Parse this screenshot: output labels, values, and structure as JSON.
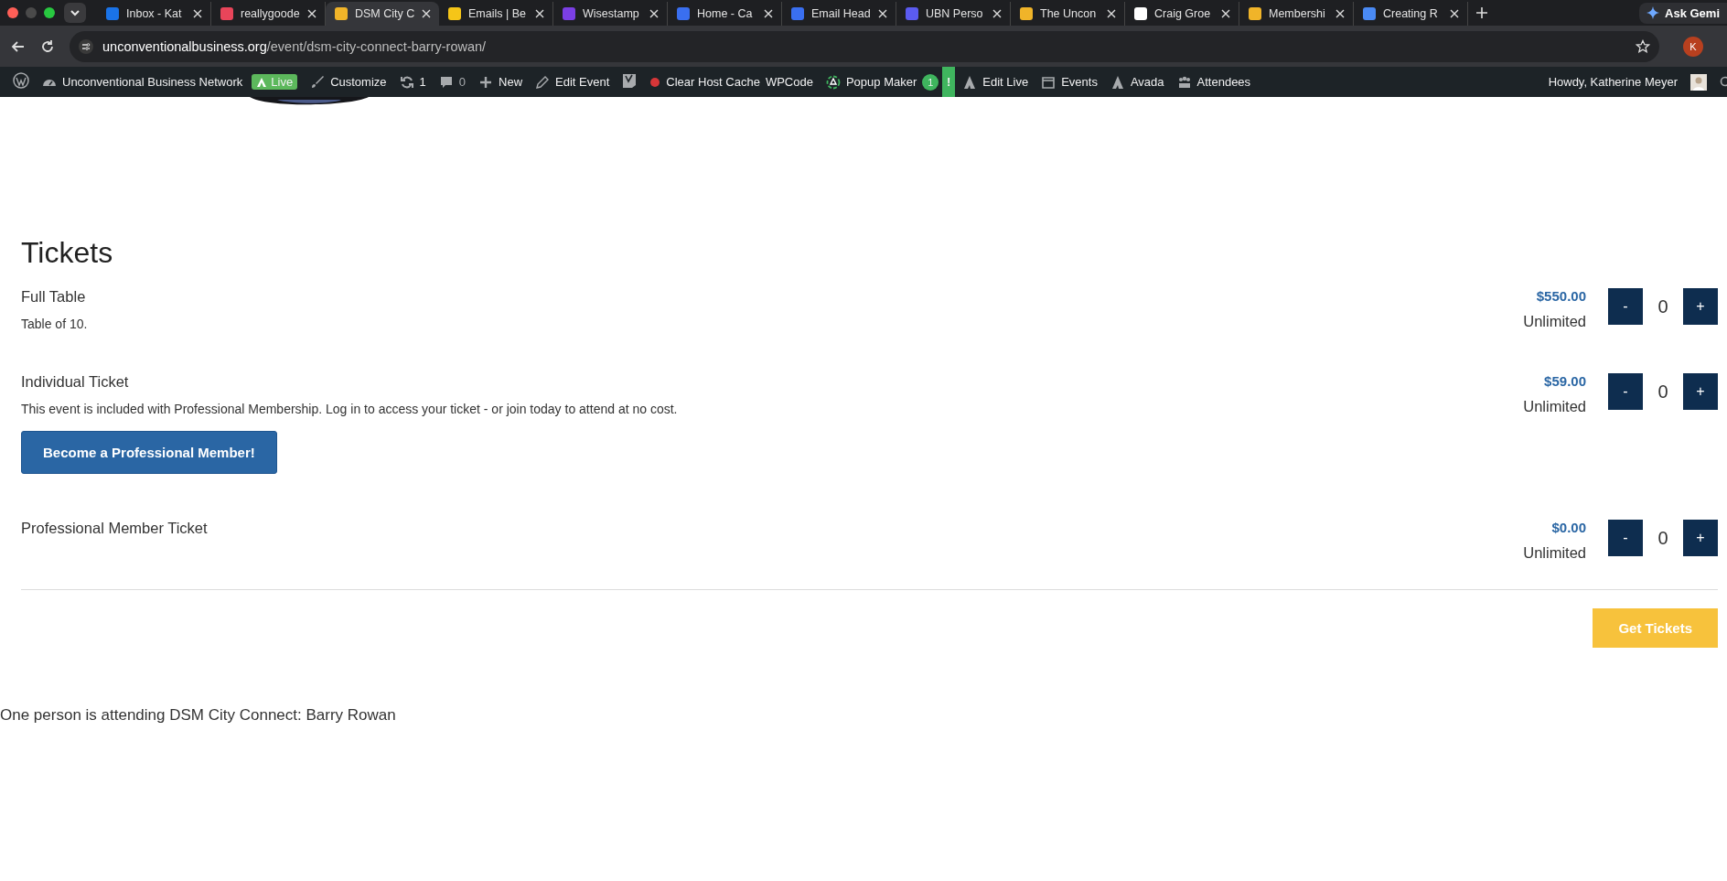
{
  "browser": {
    "tabs": [
      {
        "title": "Inbox - Kat",
        "color": "#1a73e8",
        "selected": false
      },
      {
        "title": "reallygoode",
        "color": "#e8455a",
        "selected": false
      },
      {
        "title": "DSM City C",
        "color": "#f0b429",
        "selected": true
      },
      {
        "title": "Emails | Be",
        "color": "#f5c518",
        "selected": false
      },
      {
        "title": "Wisestamp",
        "color": "#7b3fe4",
        "selected": false
      },
      {
        "title": "Home - Ca",
        "color": "#3a6ff0",
        "selected": false
      },
      {
        "title": "Email Head",
        "color": "#3a6ff0",
        "selected": false
      },
      {
        "title": "UBN Perso",
        "color": "#5b5bf0",
        "selected": false
      },
      {
        "title": "The Uncon",
        "color": "#f0b429",
        "selected": false
      },
      {
        "title": "Craig Groe",
        "color": "#ffffff",
        "selected": false
      },
      {
        "title": "Membershi",
        "color": "#f0b429",
        "selected": false
      },
      {
        "title": "Creating R",
        "color": "#4a8af4",
        "selected": false
      }
    ],
    "gemini": "Ask Gemi",
    "address": {
      "domain": "unconventionalbusiness.org",
      "path": "/event/dsm-city-connect-barry-rowan/"
    },
    "profile_initial": "K"
  },
  "admin_bar": {
    "items": [
      {
        "kind": "logo"
      },
      {
        "kind": "link",
        "label": "Unconventional Business Network"
      },
      {
        "kind": "badge",
        "label": "Live"
      },
      {
        "kind": "link",
        "label": "Customize"
      },
      {
        "kind": "link",
        "label": "1"
      },
      {
        "kind": "count",
        "label": "0"
      },
      {
        "kind": "link",
        "label": "New"
      },
      {
        "kind": "link",
        "label": "Edit Event"
      },
      {
        "kind": "logo"
      },
      {
        "kind": "dot"
      },
      {
        "kind": "link",
        "label": "Clear Host Cache"
      },
      {
        "kind": "link",
        "label": "WPCode"
      },
      {
        "kind": "link",
        "label": "Popup Maker",
        "count": "1"
      },
      {
        "kind": "alert",
        "label": "!"
      },
      {
        "kind": "link",
        "label": "Edit Live"
      },
      {
        "kind": "link",
        "label": "Events"
      },
      {
        "kind": "link",
        "label": "Avada"
      },
      {
        "kind": "link",
        "label": "Attendees"
      }
    ],
    "greeting": "Howdy, Katherine Meyer"
  },
  "tickets": {
    "title": "Tickets",
    "items": [
      {
        "name": "Full Table",
        "description": "Table of 10.",
        "price": "$550.00",
        "availability": "Unlimited",
        "quantity": "0",
        "minus": "-",
        "plus": "+"
      },
      {
        "name": "Individual Ticket",
        "description": "This event is included with Professional Membership. Log in to access your ticket - or join today to attend at no cost.",
        "action": "Become a Professional Member!",
        "price": "$59.00",
        "availability": "Unlimited",
        "quantity": "0",
        "minus": "-",
        "plus": "+"
      },
      {
        "name": "Professional Member Ticket",
        "price": "$0.00",
        "availability": "Unlimited",
        "quantity": "0",
        "minus": "-",
        "plus": "+"
      }
    ],
    "submit": "Get Tickets"
  },
  "attendance": "One person is attending DSM City Connect: Barry Rowan"
}
